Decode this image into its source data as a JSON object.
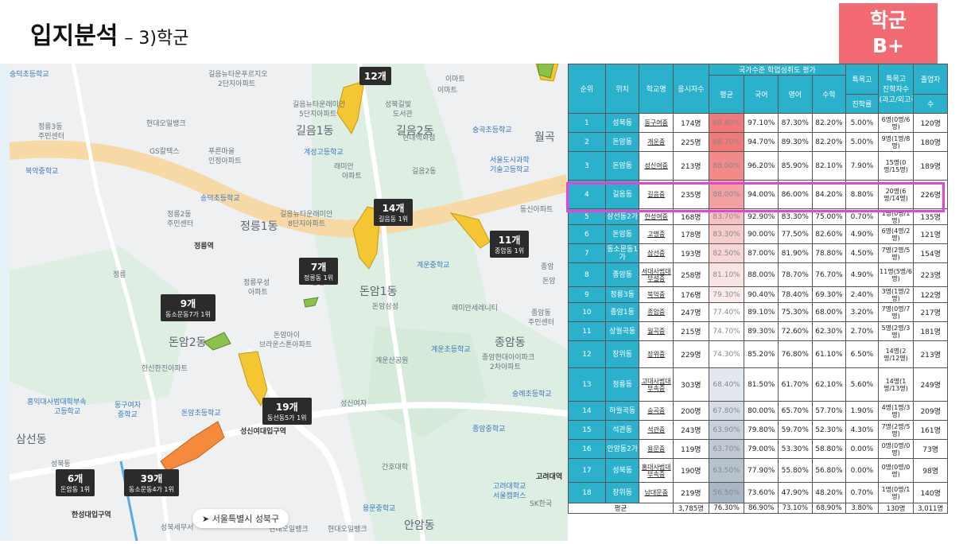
{
  "header": {
    "title": "입지분석",
    "subtitle": "– 3)학군"
  },
  "grade": {
    "line1": "학군",
    "line2": "B+"
  },
  "map": {
    "labels": [
      {
        "t": "길음뉴타운푸르지오",
        "c": "mlabel"
      },
      {
        "t": "2단지아파트",
        "c": "mlabel"
      },
      {
        "t": "길음뉴타운래미안",
        "c": "mlabel"
      },
      {
        "t": "5단지아파트",
        "c": "mlabel"
      },
      {
        "t": "길음1동",
        "c": "mlabel big"
      },
      {
        "t": "길음2동",
        "c": "mlabel big"
      },
      {
        "t": "현대오일뱅크",
        "c": "mlabel"
      },
      {
        "t": "정릉3동",
        "c": "mlabel"
      },
      {
        "t": "주민센터",
        "c": "mlabel"
      },
      {
        "t": "GS칼텍스",
        "c": "mlabel"
      },
      {
        "t": "푸른마을",
        "c": "mlabel"
      },
      {
        "t": "인정아파트",
        "c": "mlabel"
      },
      {
        "t": "계성고등학교",
        "c": "mlabel blue"
      },
      {
        "t": "북악중학교",
        "c": "mlabel blue"
      },
      {
        "t": "래미안",
        "c": "mlabel"
      },
      {
        "t": "아파트",
        "c": "mlabel"
      },
      {
        "t": "길음2동",
        "c": "mlabel"
      },
      {
        "t": "서울도시과학",
        "c": "mlabel blue"
      },
      {
        "t": "기술고등학교",
        "c": "mlabel blue"
      },
      {
        "t": "송덕초등학교",
        "c": "mlabel blue"
      },
      {
        "t": "정릉2동",
        "c": "mlabel"
      },
      {
        "t": "주민센터",
        "c": "mlabel"
      },
      {
        "t": "길음뉴타운래미안",
        "c": "mlabel"
      },
      {
        "t": "8단지아파트",
        "c": "mlabel"
      },
      {
        "t": "정릉1동",
        "c": "mlabel big"
      },
      {
        "t": "정릉역",
        "c": "mlabel dark"
      },
      {
        "t": "정릉",
        "c": "mlabel"
      },
      {
        "t": "정릉우성",
        "c": "mlabel"
      },
      {
        "t": "아파트",
        "c": "mlabel"
      },
      {
        "t": "삼성",
        "c": "mlabel"
      },
      {
        "t": "돈암1동",
        "c": "mlabel big"
      },
      {
        "t": "돈암삼성",
        "c": "mlabel"
      },
      {
        "t": "래미안세레니티",
        "c": "mlabel"
      },
      {
        "t": "돈암아이",
        "c": "mlabel"
      },
      {
        "t": "브라운스톤아파트",
        "c": "mlabel"
      },
      {
        "t": "돈암2동",
        "c": "mlabel big"
      },
      {
        "t": "한신한진아파트",
        "c": "mlabel"
      },
      {
        "t": "계운초등학교",
        "c": "mlabel blue"
      },
      {
        "t": "계운산공원",
        "c": "mlabel"
      },
      {
        "t": "종암동",
        "c": "mlabel big"
      },
      {
        "t": "종암현대아이파크",
        "c": "mlabel"
      },
      {
        "t": "2차아파트",
        "c": "mlabel"
      },
      {
        "t": "홍익대사범대학부속",
        "c": "mlabel blue"
      },
      {
        "t": "고등학교",
        "c": "mlabel blue"
      },
      {
        "t": "동구여자",
        "c": "mlabel blue"
      },
      {
        "t": "중학교",
        "c": "mlabel blue"
      },
      {
        "t": "돈암초등학교",
        "c": "mlabel blue"
      },
      {
        "t": "성신여자",
        "c": "mlabel"
      },
      {
        "t": "성신여대입구역",
        "c": "mlabel dark"
      },
      {
        "t": "숭례초등학교",
        "c": "mlabel blue"
      },
      {
        "t": "종암중학교",
        "c": "mlabel blue"
      },
      {
        "t": "삼선동",
        "c": "mlabel big"
      },
      {
        "t": "간호대학",
        "c": "mlabel"
      },
      {
        "t": "성북동",
        "c": "mlabel"
      },
      {
        "t": "고려대학교",
        "c": "mlabel blue"
      },
      {
        "t": "서울캠퍼스",
        "c": "mlabel blue"
      },
      {
        "t": "한성대입구역",
        "c": "mlabel dark"
      },
      {
        "t": "용문중학교",
        "c": "mlabel blue"
      },
      {
        "t": "안암동",
        "c": "mlabel big"
      },
      {
        "t": "현대오일뱅크",
        "c": "mlabel"
      },
      {
        "t": "이마트",
        "c": "mlabel"
      },
      {
        "t": "숭곡초등학교",
        "c": "mlabel blue"
      },
      {
        "t": "월곡",
        "c": "mlabel big"
      },
      {
        "t": "성북길빛",
        "c": "mlabel"
      },
      {
        "t": "도서관",
        "c": "mlabel"
      },
      {
        "t": "동신아파트",
        "c": "mlabel"
      },
      {
        "t": "현대백화점",
        "c": "mlabel"
      },
      {
        "t": "계운중학교",
        "c": "mlabel blue"
      },
      {
        "t": "종암동",
        "c": "mlabel"
      },
      {
        "t": "주민센터",
        "c": "mlabel"
      },
      {
        "t": "고려대역",
        "c": "mlabel dark"
      },
      {
        "t": "SK한국",
        "c": "mlabel"
      },
      {
        "t": "성북세무서",
        "c": "mlabel"
      },
      {
        "t": "현대오일뱅크",
        "c": "mlabel"
      },
      {
        "t": "종암",
        "c": "mlabel"
      },
      {
        "t": "숭덕초등학교",
        "c": "mlabel blue"
      },
      {
        "t": "돈암",
        "c": "mlabel"
      },
      {
        "t": "이마트",
        "c": "mlabel"
      }
    ],
    "tooltips": [
      {
        "count": "12개",
        "rank": ""
      },
      {
        "count": "14개",
        "rank": "길음동 1위"
      },
      {
        "count": "11개",
        "rank": "종암동 1위"
      },
      {
        "count": "7개",
        "rank": "정릉동 1위"
      },
      {
        "count": "9개",
        "rank": "동소문동7가 1위"
      },
      {
        "count": "19개",
        "rank": "동선동5가 1위"
      },
      {
        "count": "6개",
        "rank": "돈암동 1위"
      },
      {
        "count": "39개",
        "rank": "동소문동4가 1위"
      }
    ],
    "location_chip": "서울특별시 성북구"
  },
  "table": {
    "headers": {
      "rank": "순위",
      "loc": "위치",
      "school": "학교명",
      "applicants": "응시자수",
      "group": "국가수준 학업성취도 평가",
      "avg": "평균",
      "kor": "국어",
      "eng": "영어",
      "math": "수학",
      "special_a": "특목고",
      "special_b": "진학률",
      "sp_count_a": "특목고",
      "sp_count_b": "진학자수",
      "sp_count_c": "(과고/외고국제고)",
      "grads_a": "졸업자",
      "grads_b": "수"
    },
    "rows": [
      {
        "rank": "1",
        "loc": "성북동",
        "school": "동구여중",
        "applicants": "174명",
        "avg": "88.80%",
        "kor": "97.10%",
        "eng": "87.30%",
        "math": "82.20%",
        "rate": "5.00%",
        "sp": "6명(0명/6명)",
        "grads": "120명"
      },
      {
        "rank": "2",
        "loc": "돈암동",
        "school": "개운중",
        "applicants": "225명",
        "avg": "88.70%",
        "kor": "94.70%",
        "eng": "89.30%",
        "math": "82.20%",
        "rate": "5.00%",
        "sp": "9명(1명/8명)",
        "grads": "180명"
      },
      {
        "rank": "3",
        "loc": "돈암동",
        "school": "성신여중",
        "applicants": "213명",
        "avg": "88.00%",
        "kor": "96.20%",
        "eng": "85.90%",
        "math": "82.10%",
        "rate": "7.90%",
        "sp": "15명(0명/15명)",
        "grads": "189명"
      },
      {
        "rank": "4",
        "loc": "길음동",
        "school": "길음중",
        "applicants": "235명",
        "avg": "88.00%",
        "kor": "94.00%",
        "eng": "86.00%",
        "math": "84.20%",
        "rate": "8.80%",
        "sp": "20명(6명/14명)",
        "grads": "226명"
      },
      {
        "rank": "5",
        "loc": "삼선동2가",
        "school": "한성여중",
        "applicants": "168명",
        "avg": "83.70%",
        "kor": "92.90%",
        "eng": "83.30%",
        "math": "75.00%",
        "rate": "0.70%",
        "sp": "1명(0명/1명)",
        "grads": "135명"
      },
      {
        "rank": "6",
        "loc": "돈암동",
        "school": "고명중",
        "applicants": "178명",
        "avg": "83.30%",
        "kor": "90.00%",
        "eng": "77.50%",
        "math": "82.60%",
        "rate": "4.90%",
        "sp": "6명(4명/2명)",
        "grads": "121명"
      },
      {
        "rank": "7",
        "loc": "동소문동1가",
        "school": "삼선중",
        "applicants": "193명",
        "avg": "82.50%",
        "kor": "87.00%",
        "eng": "81.90%",
        "math": "78.80%",
        "rate": "4.50%",
        "sp": "7명(2명/5명)",
        "grads": "154명"
      },
      {
        "rank": "8",
        "loc": "종암동",
        "school": "서대사범대부설중",
        "applicants": "258명",
        "avg": "81.10%",
        "kor": "88.00%",
        "eng": "78.70%",
        "math": "76.70%",
        "rate": "4.90%",
        "sp": "11명(5명/6명)",
        "grads": "223명"
      },
      {
        "rank": "9",
        "loc": "정릉3동",
        "school": "북악중",
        "applicants": "176명",
        "avg": "79.30%",
        "kor": "90.40%",
        "eng": "78.40%",
        "math": "69.30%",
        "rate": "2.40%",
        "sp": "3명(1명/2명)",
        "grads": "122명"
      },
      {
        "rank": "10",
        "loc": "종암1동",
        "school": "종암중",
        "applicants": "247명",
        "avg": "77.40%",
        "kor": "89.10%",
        "eng": "75.30%",
        "math": "68.00%",
        "rate": "3.20%",
        "sp": "7명(0명/7명)",
        "grads": "217명"
      },
      {
        "rank": "11",
        "loc": "상월곡동",
        "school": "월곡중",
        "applicants": "215명",
        "avg": "74.70%",
        "kor": "89.30%",
        "eng": "72.60%",
        "math": "62.30%",
        "rate": "2.70%",
        "sp": "5명(2명/3명)",
        "grads": "181명"
      },
      {
        "rank": "12",
        "loc": "장위동",
        "school": "장위중",
        "applicants": "229명",
        "avg": "74.30%",
        "kor": "85.20%",
        "eng": "76.80%",
        "math": "61.10%",
        "rate": "6.50%",
        "sp": "14명(2명/12명)",
        "grads": "213명"
      },
      {
        "rank": "13",
        "loc": "정릉동",
        "school": "고대사범대부속중",
        "applicants": "303명",
        "avg": "68.40%",
        "kor": "81.50%",
        "eng": "61.70%",
        "math": "62.10%",
        "rate": "5.60%",
        "sp": "14명(1명/13명)",
        "grads": "249명"
      },
      {
        "rank": "14",
        "loc": "하월곡동",
        "school": "숭곡중",
        "applicants": "200명",
        "avg": "67.80%",
        "kor": "80.00%",
        "eng": "65.70%",
        "math": "57.70%",
        "rate": "1.90%",
        "sp": "4명(1명/3명)",
        "grads": "209명"
      },
      {
        "rank": "15",
        "loc": "석관동",
        "school": "석관중",
        "applicants": "243명",
        "avg": "63.90%",
        "kor": "79.80%",
        "eng": "59.70%",
        "math": "52.30%",
        "rate": "4.30%",
        "sp": "7명(2명/5명)",
        "grads": "161명"
      },
      {
        "rank": "16",
        "loc": "안암동2가",
        "school": "용문중",
        "applicants": "119명",
        "avg": "63.70%",
        "kor": "79.00%",
        "eng": "53.30%",
        "math": "58.80%",
        "rate": "0.00%",
        "sp": "0명(0명/0명)",
        "grads": "73명"
      },
      {
        "rank": "17",
        "loc": "성북동",
        "school": "홍대사범대부속중",
        "applicants": "190명",
        "avg": "63.50%",
        "kor": "77.90%",
        "eng": "55.80%",
        "math": "56.80%",
        "rate": "0.00%",
        "sp": "0명(0명/0명)",
        "grads": "98명"
      },
      {
        "rank": "18",
        "loc": "장위동",
        "school": "남대문중",
        "applicants": "219명",
        "avg": "56.50%",
        "kor": "73.60%",
        "eng": "47.90%",
        "math": "48.20%",
        "rate": "0.70%",
        "sp": "1명(0명/1명)",
        "grads": "140명"
      }
    ],
    "footer": {
      "label": "평균",
      "applicants": "3,785명",
      "avg": "76.30%",
      "kor": "86.90%",
      "eng": "73.10%",
      "math": "68.90%",
      "rate": "3.80%",
      "sp": "130명",
      "grads": "3,011명"
    },
    "avg_colors": [
      "#f07a7a",
      "#f07a7a",
      "#f28a8a",
      "#f4a0a0",
      "#f6c1c1",
      "#f7cccc",
      "#f8d6d6",
      "#f9e4e4",
      "#fbeded",
      "#fff",
      "#fff",
      "#fff",
      "#e3e8ee",
      "#d6dde6",
      "#c8d1dc",
      "#c0cad6",
      "#b7c2cf",
      "#a9b6c5"
    ]
  }
}
